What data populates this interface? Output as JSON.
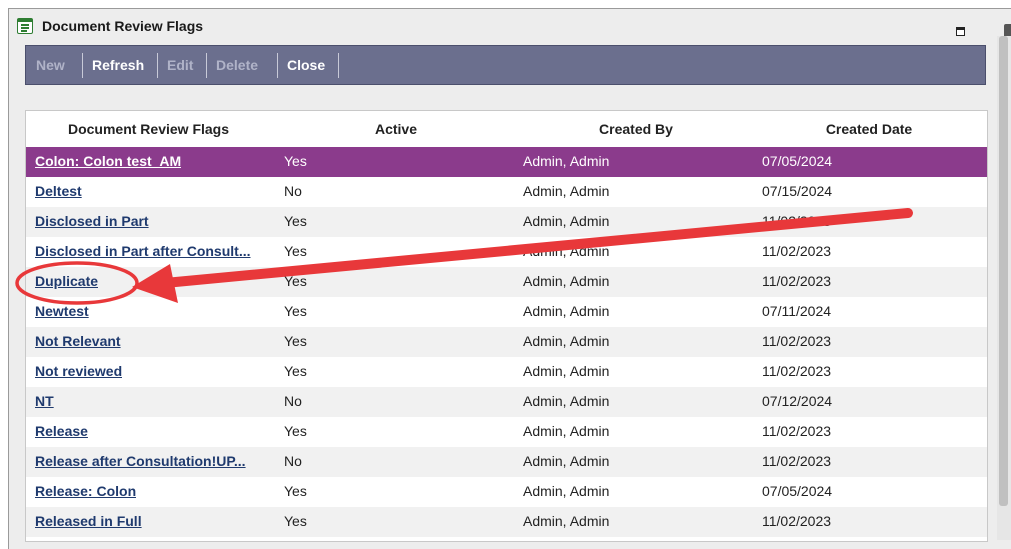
{
  "window": {
    "title": "Document Review Flags"
  },
  "toolbar": {
    "buttons": [
      {
        "label": "New",
        "enabled": false
      },
      {
        "label": "Refresh",
        "enabled": true
      },
      {
        "label": "Edit",
        "enabled": false
      },
      {
        "label": "Delete",
        "enabled": false
      },
      {
        "label": "Close",
        "enabled": true
      }
    ]
  },
  "grid": {
    "columns": [
      "Document Review Flags",
      "Active",
      "Created By",
      "Created Date"
    ],
    "rows": [
      {
        "name": "Colon: Colon test_AM",
        "active": "Yes",
        "created_by": "Admin, Admin",
        "created_date": "07/05/2024",
        "selected": true
      },
      {
        "name": "Deltest",
        "active": "No",
        "created_by": "Admin, Admin",
        "created_date": "07/15/2024"
      },
      {
        "name": "Disclosed in Part",
        "active": "Yes",
        "created_by": "Admin, Admin",
        "created_date": "11/02/2023"
      },
      {
        "name": "Disclosed in Part after Consult...",
        "active": "Yes",
        "created_by": "Admin, Admin",
        "created_date": "11/02/2023"
      },
      {
        "name": "Duplicate",
        "active": "Yes",
        "created_by": "Admin, Admin",
        "created_date": "11/02/2023"
      },
      {
        "name": "Newtest",
        "active": "Yes",
        "created_by": "Admin, Admin",
        "created_date": "07/11/2024"
      },
      {
        "name": "Not Relevant",
        "active": "Yes",
        "created_by": "Admin, Admin",
        "created_date": "11/02/2023"
      },
      {
        "name": "Not reviewed",
        "active": "Yes",
        "created_by": "Admin, Admin",
        "created_date": "11/02/2023"
      },
      {
        "name": "NT",
        "active": "No",
        "created_by": "Admin, Admin",
        "created_date": "07/12/2024"
      },
      {
        "name": "Release",
        "active": "Yes",
        "created_by": "Admin, Admin",
        "created_date": "11/02/2023"
      },
      {
        "name": "Release after Consultation!UP...",
        "active": "No",
        "created_by": "Admin, Admin",
        "created_date": "11/02/2023"
      },
      {
        "name": "Release: Colon",
        "active": "Yes",
        "created_by": "Admin, Admin",
        "created_date": "07/05/2024"
      },
      {
        "name": "Released in Full",
        "active": "Yes",
        "created_by": "Admin, Admin",
        "created_date": "11/02/2023"
      }
    ]
  },
  "colors": {
    "toolbar": "#6b6f8e",
    "selected_row": "#8b3b8c",
    "link": "#1f3a6e",
    "annotation": "#e8383a"
  },
  "icons": [
    "document-list-icon",
    "maximize-icon"
  ]
}
